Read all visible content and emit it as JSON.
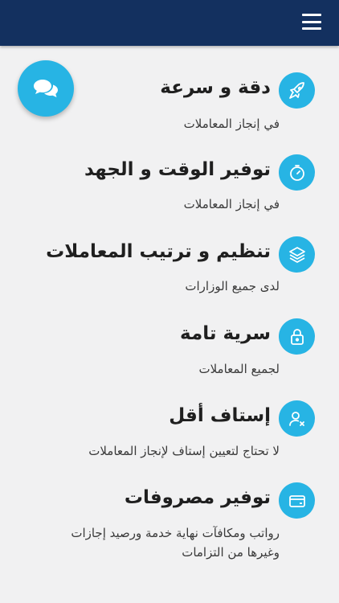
{
  "header": {
    "menu_icon": "hamburger-menu-icon",
    "background": "#13305f"
  },
  "chat_button": {
    "icon": "chat-bubbles-icon",
    "color": "#27b4e4"
  },
  "features": [
    {
      "icon": "rocket-icon",
      "title": "دقة و سرعة",
      "description": "في إنجاز المعاملات"
    },
    {
      "icon": "clock-icon",
      "title": "توفير الوقت و الجهد",
      "description": "في إنجاز المعاملات"
    },
    {
      "icon": "layers-icon",
      "title": "تنظيم و ترتيب المعاملات",
      "description": "لدى جميع الوزارات"
    },
    {
      "icon": "lock-icon",
      "title": "سرية تامة",
      "description": "لجميع المعاملات"
    },
    {
      "icon": "user-remove-icon",
      "title": "إستاف أقل",
      "description": "لا تحتاج لتعيين إستاف لإنجاز المعاملات"
    },
    {
      "icon": "wallet-icon",
      "title": "توفير مصروفات",
      "description": "رواتب ومكافآت نهاية خدمة ورصيد إجازات وغيرها من التزامات"
    }
  ],
  "accent_color": "#27b4e4"
}
